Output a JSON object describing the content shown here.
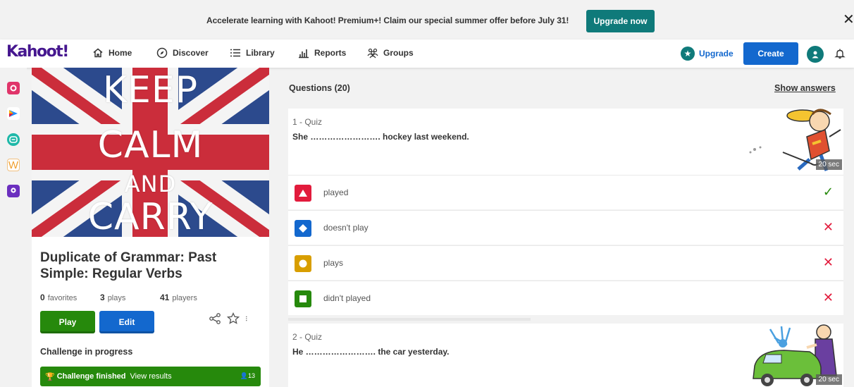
{
  "promo": {
    "text": "Accelerate learning with Kahoot! Premium+! Claim our special summer offer before July 31!",
    "button": "Upgrade now",
    "close_icon": "close-icon"
  },
  "nav": {
    "logo": "Kahoot!",
    "home": "Home",
    "discover": "Discover",
    "library": "Library",
    "reports": "Reports",
    "groups": "Groups",
    "upgrade": "Upgrade",
    "create": "Create"
  },
  "apps": [
    "app-red-icon",
    "app-arrow-icon",
    "app-teal-icon",
    "app-w-icon",
    "app-purple-icon"
  ],
  "kahoot": {
    "cover_lines": [
      "KEEP",
      "CALM",
      "AND",
      "CARRY"
    ],
    "title": "Duplicate of Grammar: Past Simple: Regular Verbs",
    "favorites_count": "0",
    "favorites_label": "favorites",
    "plays_count": "3",
    "plays_label": "plays",
    "players_count": "41",
    "players_label": "players",
    "play": "Play",
    "edit": "Edit",
    "challenge_label": "Challenge in progress",
    "challenge_finished": "Challenge finished",
    "view_results": "View results",
    "challenge_count": "13"
  },
  "questions": {
    "header": "Questions (20)",
    "show_answers": "Show answers",
    "items": [
      {
        "number": "1 - Quiz",
        "text": "She ……………………. hockey last weekend.",
        "time": "20 sec",
        "answers": [
          {
            "text": "played",
            "shape": "triangle",
            "color": "#e21b3c",
            "correct": true
          },
          {
            "text": "doesn't play",
            "shape": "diamond",
            "color": "#1368ce",
            "correct": false
          },
          {
            "text": "plays",
            "shape": "circle",
            "color": "#d89e00",
            "correct": false
          },
          {
            "text": "didn't played",
            "shape": "square",
            "color": "#26890c",
            "correct": false
          }
        ]
      },
      {
        "number": "2 - Quiz",
        "text": "He ……………………. the car yesterday.",
        "time": "20 sec"
      }
    ]
  },
  "colors": {
    "brand": "#46178f",
    "primary": "#1368ce",
    "teal": "#0f7a7a",
    "green": "#26890c",
    "red": "#e21b3c"
  }
}
